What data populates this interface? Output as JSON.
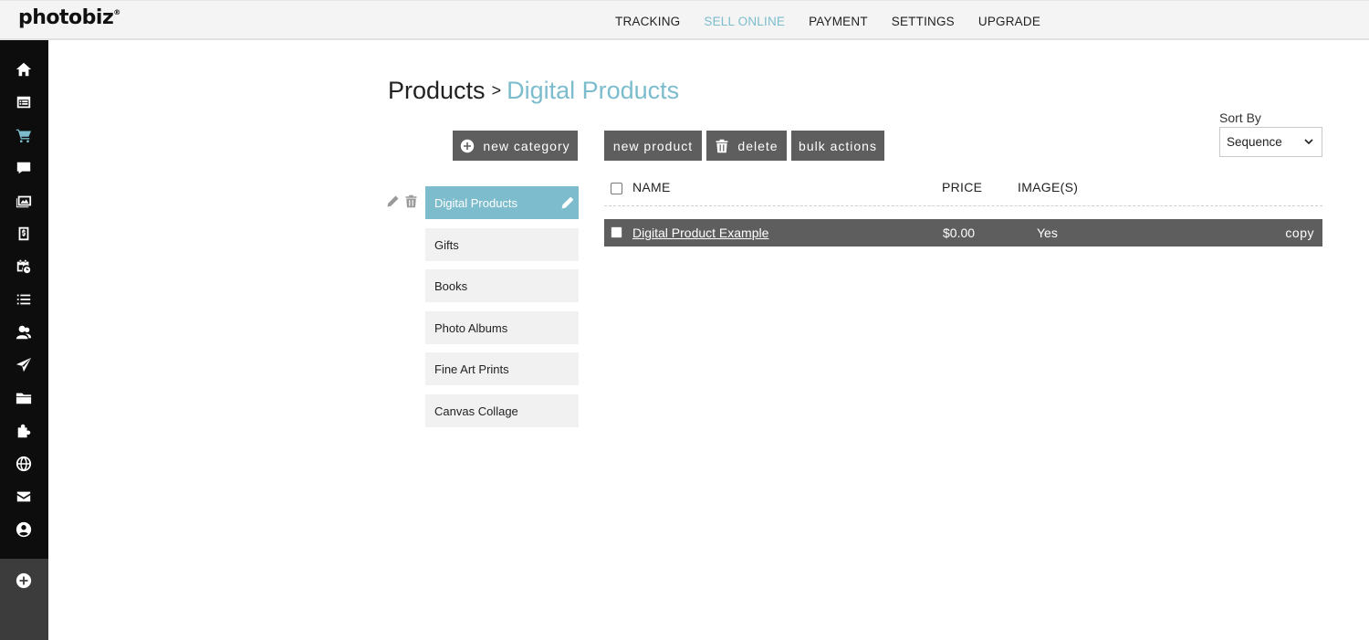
{
  "brand": {
    "logo": "photobiz",
    "logo_mark": "®"
  },
  "topnav": {
    "items": [
      {
        "label": "TRACKING"
      },
      {
        "label": "SELL ONLINE"
      },
      {
        "label": "PAYMENT"
      },
      {
        "label": "SETTINGS"
      },
      {
        "label": "UPGRADE"
      }
    ],
    "active_color": "#7cbccd"
  },
  "sidebar": {
    "icons": [
      "home-icon",
      "calendar-list-icon",
      "cart-icon",
      "chat-icon",
      "photos-icon",
      "invoice-icon",
      "calendar-clock-icon",
      "list-icon",
      "users-icon",
      "send-icon",
      "folder-icon",
      "puzzle-icon",
      "globe-icon",
      "mail-icon",
      "account-icon",
      "add-icon"
    ],
    "active": "cart-icon"
  },
  "breadcrumb": {
    "root": "Products",
    "separator": ">",
    "current": "Digital Products"
  },
  "toolbar": {
    "new_category": "new category",
    "new_product": "new product",
    "delete": "delete",
    "bulk_actions": "bulk actions"
  },
  "sort": {
    "label": "Sort By",
    "value": "Sequence"
  },
  "categories": [
    {
      "label": "Digital Products"
    },
    {
      "label": "Gifts"
    },
    {
      "label": "Books"
    },
    {
      "label": "Photo Albums"
    },
    {
      "label": "Fine Art Prints"
    },
    {
      "label": "Canvas Collage"
    }
  ],
  "table": {
    "columns": {
      "name": "NAME",
      "price": "PRICE",
      "images": "IMAGE(S)"
    },
    "rows": [
      {
        "name": "Digital Product Example",
        "price": "$0.00",
        "images": "Yes",
        "action": "copy"
      }
    ]
  },
  "colors": {
    "accent": "#7cbccd",
    "button": "#5e5e5e",
    "sidebar": "#0d0d0d"
  }
}
